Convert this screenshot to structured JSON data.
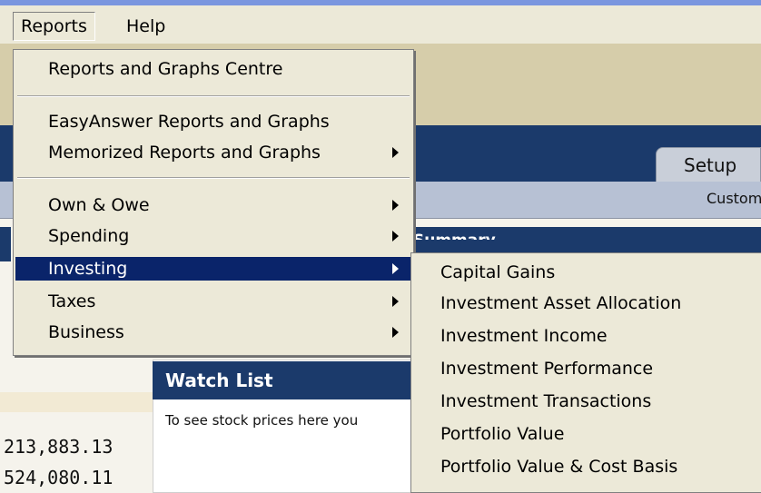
{
  "menubar": {
    "reports": "Reports",
    "help": "Help"
  },
  "background": {
    "setup_tab": "Setup",
    "customize_text": "Custom",
    "summary_header": "Summary",
    "watch_list_title": "Watch List",
    "watch_list_text": "To see stock prices here you",
    "amount_1": "213,883.13",
    "amount_2": "524,080.11"
  },
  "reports_menu": {
    "items": [
      {
        "label": "Reports and Graphs Centre"
      },
      {
        "label": "EasyAnswer Reports and Graphs"
      },
      {
        "label": "Memorized Reports and Graphs"
      },
      {
        "label": "Own & Owe"
      },
      {
        "label": "Spending"
      },
      {
        "label": "Investing"
      },
      {
        "label": "Taxes"
      },
      {
        "label": "Business"
      }
    ]
  },
  "investing_submenu": {
    "items": [
      {
        "label": "Capital Gains"
      },
      {
        "label": "Investment Asset Allocation"
      },
      {
        "label": "Investment Income"
      },
      {
        "label": "Investment Performance"
      },
      {
        "label": "Investment Transactions"
      },
      {
        "label": "Portfolio Value"
      },
      {
        "label": "Portfolio Value & Cost Basis"
      }
    ]
  },
  "colors": {
    "selection": "#0a246a",
    "navy": "#1b3a6b",
    "menu_bg": "#ece9d8"
  }
}
